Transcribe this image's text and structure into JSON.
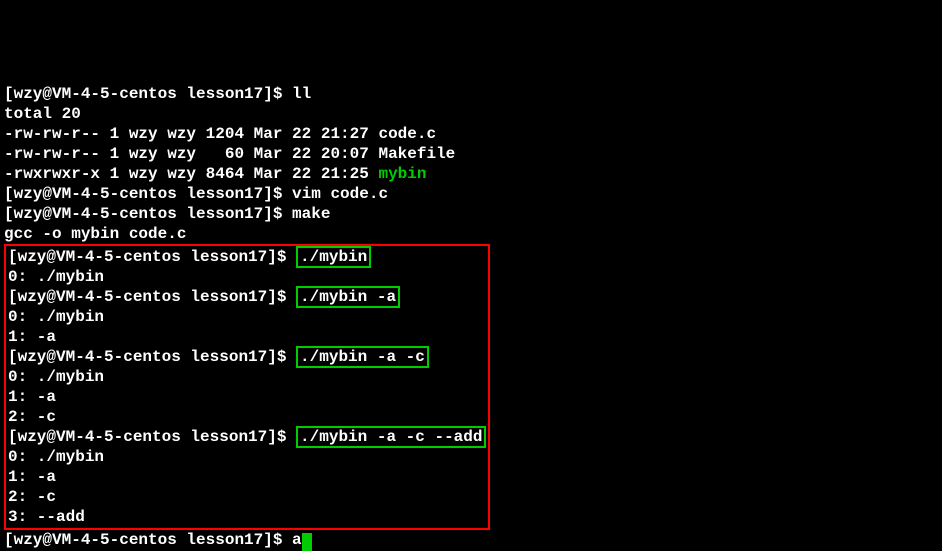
{
  "prompt": "[wzy@VM-4-5-centos lesson17]$ ",
  "cmd_ll": "ll",
  "ll_output": "total 20\n-rw-rw-r-- 1 wzy wzy 1204 Mar 22 21:27 code.c\n-rw-rw-r-- 1 wzy wzy   60 Mar 22 20:07 Makefile\n-rwxrwxr-x 1 wzy wzy 8464 Mar 22 21:25 ",
  "ll_exec": "mybin",
  "cmd_vim": "vim code.c",
  "cmd_make": "make",
  "make_output": "gcc -o mybin code.c",
  "runs": [
    {
      "cmd": "./mybin",
      "out": "0: ./mybin"
    },
    {
      "cmd": "./mybin -a",
      "out": "0: ./mybin\n1: -a"
    },
    {
      "cmd": "./mybin -a -c",
      "out": "0: ./mybin\n1: -a\n2: -c"
    },
    {
      "cmd": "./mybin -a -c --add",
      "out": "0: ./mybin\n1: -a\n2: -c\n3: --add"
    }
  ],
  "tail_cmd": "a"
}
